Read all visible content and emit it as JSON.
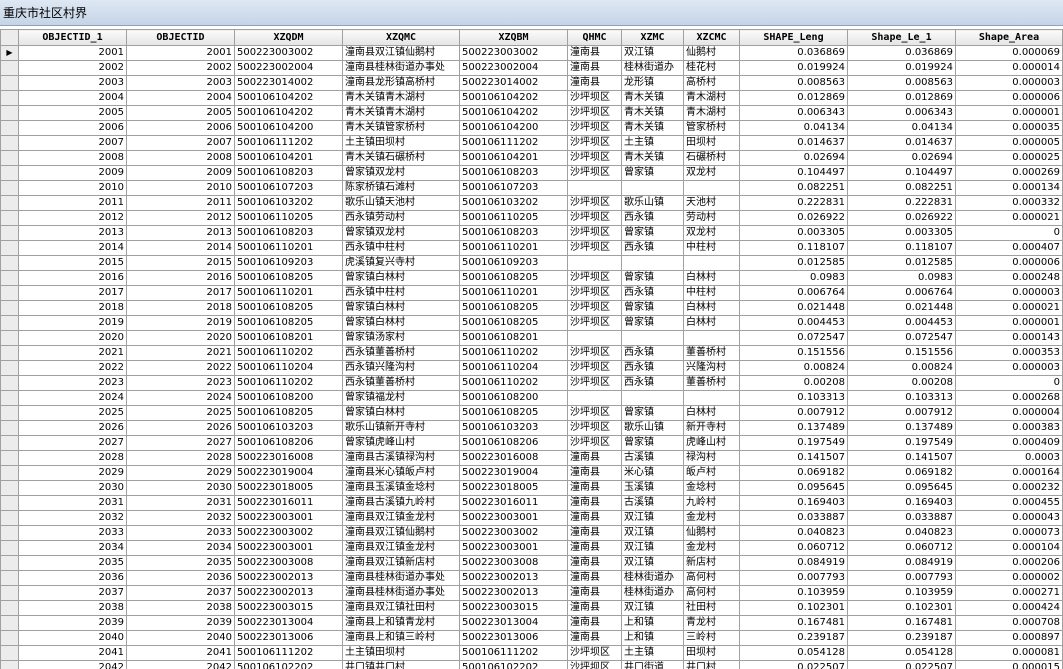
{
  "window": {
    "title": "重庆市社区村界"
  },
  "table": {
    "columns": [
      "OBJECTID_1",
      "OBJECTID",
      "XZQDM",
      "XZQMC",
      "XZQBM",
      "QHMC",
      "XZMC",
      "XZCMC",
      "SHAPE_Leng",
      "Shape_Le_1",
      "Shape_Area"
    ],
    "rows": [
      [
        "2001",
        "2001",
        "500223003002",
        "潼南县双江镇仙鹅村",
        "500223003002",
        "潼南县",
        "双江镇",
        "仙鹅村",
        "0.036869",
        "0.036869",
        "0.000069"
      ],
      [
        "2002",
        "2002",
        "500223002004",
        "潼南县桂林街道办事处",
        "500223002004",
        "潼南县",
        "桂林街道办",
        "桂花村",
        "0.019924",
        "0.019924",
        "0.000014"
      ],
      [
        "2003",
        "2003",
        "500223014002",
        "潼南县龙形镇高桥村",
        "500223014002",
        "潼南县",
        "龙形镇",
        "高桥村",
        "0.008563",
        "0.008563",
        "0.000003"
      ],
      [
        "2004",
        "2004",
        "500106104202",
        "青木关镇青木湖村",
        "500106104202",
        "沙坪坝区",
        "青木关镇",
        "青木湖村",
        "0.012869",
        "0.012869",
        "0.000006"
      ],
      [
        "2005",
        "2005",
        "500106104202",
        "青木关镇青木湖村",
        "500106104202",
        "沙坪坝区",
        "青木关镇",
        "青木湖村",
        "0.006343",
        "0.006343",
        "0.000001"
      ],
      [
        "2006",
        "2006",
        "500106104200",
        "青木关镇管家桥村",
        "500106104200",
        "沙坪坝区",
        "青木关镇",
        "管家桥村",
        "0.04134",
        "0.04134",
        "0.000035"
      ],
      [
        "2007",
        "2007",
        "500106111202",
        "土主镇田坝村",
        "500106111202",
        "沙坪坝区",
        "土主镇",
        "田坝村",
        "0.014637",
        "0.014637",
        "0.000005"
      ],
      [
        "2008",
        "2008",
        "500106104201",
        "青木关镇石碾桥村",
        "500106104201",
        "沙坪坝区",
        "青木关镇",
        "石碾桥村",
        "0.02694",
        "0.02694",
        "0.000025"
      ],
      [
        "2009",
        "2009",
        "500106108203",
        "曾家镇双龙村",
        "500106108203",
        "沙坪坝区",
        "曾家镇",
        "双龙村",
        "0.104497",
        "0.104497",
        "0.000269"
      ],
      [
        "2010",
        "2010",
        "500106107203",
        "陈家桥镇石滩村",
        "500106107203",
        "",
        "",
        "",
        "0.082251",
        "0.082251",
        "0.000134"
      ],
      [
        "2011",
        "2011",
        "500106103202",
        "歌乐山镇天池村",
        "500106103202",
        "沙坪坝区",
        "歌乐山镇",
        "天池村",
        "0.222831",
        "0.222831",
        "0.000332"
      ],
      [
        "2012",
        "2012",
        "500106110205",
        "西永镇劳动村",
        "500106110205",
        "沙坪坝区",
        "西永镇",
        "劳动村",
        "0.026922",
        "0.026922",
        "0.000021"
      ],
      [
        "2013",
        "2013",
        "500106108203",
        "曾家镇双龙村",
        "500106108203",
        "沙坪坝区",
        "曾家镇",
        "双龙村",
        "0.003305",
        "0.003305",
        "0"
      ],
      [
        "2014",
        "2014",
        "500106110201",
        "西永镇中柱村",
        "500106110201",
        "沙坪坝区",
        "西永镇",
        "中柱村",
        "0.118107",
        "0.118107",
        "0.000407"
      ],
      [
        "2015",
        "2015",
        "500106109203",
        "虎溪镇复兴寺村",
        "500106109203",
        "",
        "",
        "",
        "0.012585",
        "0.012585",
        "0.000006"
      ],
      [
        "2016",
        "2016",
        "500106108205",
        "曾家镇白林村",
        "500106108205",
        "沙坪坝区",
        "曾家镇",
        "白林村",
        "0.0983",
        "0.0983",
        "0.000248"
      ],
      [
        "2017",
        "2017",
        "500106110201",
        "西永镇中柱村",
        "500106110201",
        "沙坪坝区",
        "西永镇",
        "中柱村",
        "0.006764",
        "0.006764",
        "0.000003"
      ],
      [
        "2018",
        "2018",
        "500106108205",
        "曾家镇白林村",
        "500106108205",
        "沙坪坝区",
        "曾家镇",
        "白林村",
        "0.021448",
        "0.021448",
        "0.000021"
      ],
      [
        "2019",
        "2019",
        "500106108205",
        "曾家镇白林村",
        "500106108205",
        "沙坪坝区",
        "曾家镇",
        "白林村",
        "0.004453",
        "0.004453",
        "0.000001"
      ],
      [
        "2020",
        "2020",
        "500106108201",
        "曾家镇汤家村",
        "500106108201",
        "",
        "",
        "",
        "0.072547",
        "0.072547",
        "0.000143"
      ],
      [
        "2021",
        "2021",
        "500106110202",
        "西永镇董善桥村",
        "500106110202",
        "沙坪坝区",
        "西永镇",
        "董善桥村",
        "0.151556",
        "0.151556",
        "0.000353"
      ],
      [
        "2022",
        "2022",
        "500106110204",
        "西永镇兴隆沟村",
        "500106110204",
        "沙坪坝区",
        "西永镇",
        "兴隆沟村",
        "0.00824",
        "0.00824",
        "0.000003"
      ],
      [
        "2023",
        "2023",
        "500106110202",
        "西永镇董善桥村",
        "500106110202",
        "沙坪坝区",
        "西永镇",
        "董善桥村",
        "0.00208",
        "0.00208",
        "0"
      ],
      [
        "2024",
        "2024",
        "500106108200",
        "曾家镇福龙村",
        "500106108200",
        "",
        "",
        "",
        "0.103313",
        "0.103313",
        "0.000268"
      ],
      [
        "2025",
        "2025",
        "500106108205",
        "曾家镇白林村",
        "500106108205",
        "沙坪坝区",
        "曾家镇",
        "白林村",
        "0.007912",
        "0.007912",
        "0.000004"
      ],
      [
        "2026",
        "2026",
        "500106103203",
        "歌乐山镇新开寺村",
        "500106103203",
        "沙坪坝区",
        "歌乐山镇",
        "新开寺村",
        "0.137489",
        "0.137489",
        "0.000383"
      ],
      [
        "2027",
        "2027",
        "500106108206",
        "曾家镇虎峰山村",
        "500106108206",
        "沙坪坝区",
        "曾家镇",
        "虎峰山村",
        "0.197549",
        "0.197549",
        "0.000409"
      ],
      [
        "2028",
        "2028",
        "500223016008",
        "潼南县古溪镇禄沟村",
        "500223016008",
        "潼南县",
        "古溪镇",
        "禄沟村",
        "0.141507",
        "0.141507",
        "0.0003"
      ],
      [
        "2029",
        "2029",
        "500223019004",
        "潼南县米心镇皈卢村",
        "500223019004",
        "潼南县",
        "米心镇",
        "皈卢村",
        "0.069182",
        "0.069182",
        "0.000164"
      ],
      [
        "2030",
        "2030",
        "500223018005",
        "潼南县玉溪镇金埝村",
        "500223018005",
        "潼南县",
        "玉溪镇",
        "金埝村",
        "0.095645",
        "0.095645",
        "0.000232"
      ],
      [
        "2031",
        "2031",
        "500223016011",
        "潼南县古溪镇九岭村",
        "500223016011",
        "潼南县",
        "古溪镇",
        "九岭村",
        "0.169403",
        "0.169403",
        "0.000455"
      ],
      [
        "2032",
        "2032",
        "500223003001",
        "潼南县双江镇金龙村",
        "500223003001",
        "潼南县",
        "双江镇",
        "金龙村",
        "0.033887",
        "0.033887",
        "0.000043"
      ],
      [
        "2033",
        "2033",
        "500223003002",
        "潼南县双江镇仙鹅村",
        "500223003002",
        "潼南县",
        "双江镇",
        "仙鹅村",
        "0.040823",
        "0.040823",
        "0.000073"
      ],
      [
        "2034",
        "2034",
        "500223003001",
        "潼南县双江镇金龙村",
        "500223003001",
        "潼南县",
        "双江镇",
        "金龙村",
        "0.060712",
        "0.060712",
        "0.000104"
      ],
      [
        "2035",
        "2035",
        "500223003008",
        "潼南县双江镇新店村",
        "500223003008",
        "潼南县",
        "双江镇",
        "新店村",
        "0.084919",
        "0.084919",
        "0.000206"
      ],
      [
        "2036",
        "2036",
        "500223002013",
        "潼南县桂林街道办事处",
        "500223002013",
        "潼南县",
        "桂林街道办",
        "高何村",
        "0.007793",
        "0.007793",
        "0.000002"
      ],
      [
        "2037",
        "2037",
        "500223002013",
        "潼南县桂林街道办事处",
        "500223002013",
        "潼南县",
        "桂林街道办",
        "高何村",
        "0.103959",
        "0.103959",
        "0.000271"
      ],
      [
        "2038",
        "2038",
        "500223003015",
        "潼南县双江镇社田村",
        "500223003015",
        "潼南县",
        "双江镇",
        "社田村",
        "0.102301",
        "0.102301",
        "0.000424"
      ],
      [
        "2039",
        "2039",
        "500223013004",
        "潼南县上和镇青龙村",
        "500223013004",
        "潼南县",
        "上和镇",
        "青龙村",
        "0.167481",
        "0.167481",
        "0.000708"
      ],
      [
        "2040",
        "2040",
        "500223013006",
        "潼南县上和镇三岭村",
        "500223013006",
        "潼南县",
        "上和镇",
        "三岭村",
        "0.239187",
        "0.239187",
        "0.000897"
      ],
      [
        "2041",
        "2041",
        "500106111202",
        "土主镇田坝村",
        "500106111202",
        "沙坪坝区",
        "土主镇",
        "田坝村",
        "0.054128",
        "0.054128",
        "0.000081"
      ],
      [
        "2042",
        "2042",
        "500106102202",
        "井口镇井口村",
        "500106102202",
        "沙坪坝区",
        "井口街道",
        "井口村",
        "0.022507",
        "0.022507",
        "0.000015"
      ]
    ],
    "row_pointer": "▶"
  }
}
